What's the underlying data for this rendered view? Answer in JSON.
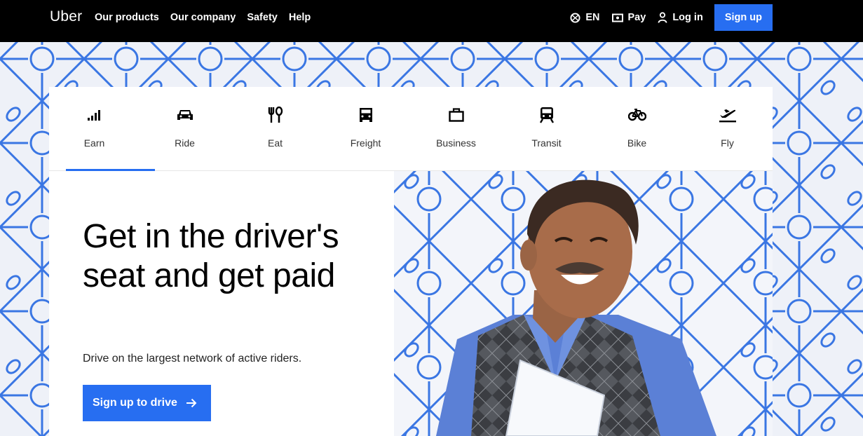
{
  "brand": {
    "logo_text": "Uber",
    "accent_color": "#276ef1"
  },
  "topnav": {
    "links": [
      "Our products",
      "Our company",
      "Safety",
      "Help"
    ],
    "language": {
      "icon": "globe-icon",
      "label": "EN"
    },
    "pay": {
      "icon": "wallet-icon",
      "label": "Pay"
    },
    "login": {
      "icon": "person-icon",
      "label": "Log in"
    },
    "signup_label": "Sign up"
  },
  "tabs": [
    {
      "label": "Earn",
      "icon": "signal-bars-icon",
      "active": true
    },
    {
      "label": "Ride",
      "icon": "car-icon",
      "active": false
    },
    {
      "label": "Eat",
      "icon": "fork-knife-icon",
      "active": false
    },
    {
      "label": "Freight",
      "icon": "truck-icon",
      "active": false
    },
    {
      "label": "Business",
      "icon": "briefcase-icon",
      "active": false
    },
    {
      "label": "Transit",
      "icon": "train-icon",
      "active": false
    },
    {
      "label": "Bike",
      "icon": "bicycle-icon",
      "active": false
    },
    {
      "label": "Fly",
      "icon": "plane-icon",
      "active": false
    }
  ],
  "hero": {
    "headline": "Get in the driver's seat and get paid",
    "subtext": "Drive on the largest network of active riders.",
    "cta_label": "Sign up to drive"
  }
}
